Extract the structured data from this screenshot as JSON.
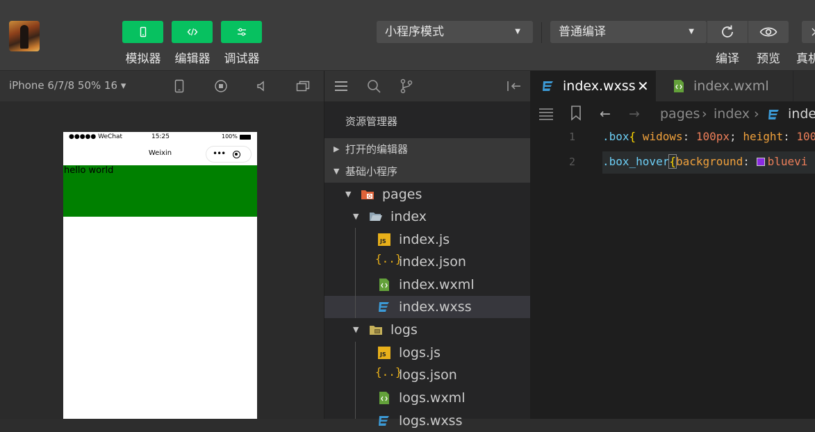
{
  "toolbar": {
    "buttons": [
      {
        "label": "模拟器",
        "icon": "phone-icon"
      },
      {
        "label": "编辑器",
        "icon": "code-icon"
      },
      {
        "label": "调试器",
        "icon": "debug-sliders-icon"
      }
    ],
    "mode_select": "小程序模式",
    "compile_select": "普通编译",
    "right_labels": {
      "compile": "编译",
      "preview": "预览",
      "realdevice": "真机"
    }
  },
  "simulator": {
    "device": "iPhone 6/7/8 50% 16 ▾",
    "status": {
      "carrier": "●●●●● WeChat",
      "time": "15:25",
      "battery": "100%"
    },
    "nav_title": "Weixin",
    "content_text": "hello world",
    "content_bg": "#008000"
  },
  "explorer": {
    "title": "资源管理器",
    "sections": {
      "open_editors": "打开的编辑器",
      "project": "基础小程序"
    },
    "tree": {
      "pages": "pages",
      "index": "index",
      "index_js": "index.js",
      "index_json": "index.json",
      "index_wxml": "index.wxml",
      "index_wxss": "index.wxss",
      "logs": "logs",
      "logs_js": "logs.js",
      "logs_json": "logs.json",
      "logs_wxml": "logs.wxml",
      "logs_wxss": "logs.wxss"
    }
  },
  "editor": {
    "tabs": {
      "active": "index.wxss",
      "inactive": "index.wxml"
    },
    "breadcrumb": {
      "a": "pages",
      "b": "index",
      "c": "inde"
    },
    "lines": [
      {
        "num": "1",
        "selector": ".box",
        "brace": "{",
        "p1": " widows",
        "c1": ": ",
        "v1": "100px",
        "s1": "; ",
        "p2": "height",
        "c2": ": ",
        "v2": "100"
      },
      {
        "num": "2",
        "selector": ".box_hover",
        "brace": "{",
        "p1": "background",
        "c1": ": ",
        "v1": "bluevi"
      }
    ],
    "accent": "#07c160"
  }
}
